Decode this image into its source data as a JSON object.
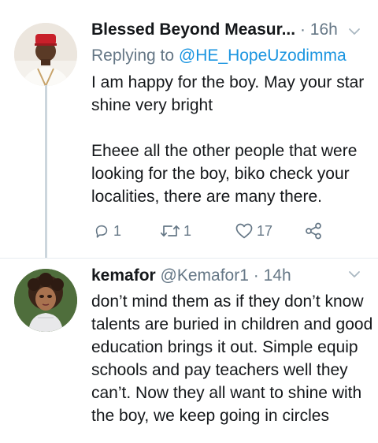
{
  "tweets": [
    {
      "name": "Blessed Beyond Measur...",
      "time": "16h",
      "reply_prefix": "Replying to",
      "reply_to": "@HE_HopeUzodimma",
      "text": "I am happy for the boy. May your star shine very bright\n\nEheee all the other people that were looking for the boy, biko check your localities, there are many there.",
      "counts": {
        "replies": "1",
        "retweets": "1",
        "likes": "17"
      }
    },
    {
      "name": "kemafor",
      "handle": "@Kemafor1",
      "time": "14h",
      "text": "don’t mind them as if they don’t know talents are buried in children and good education brings it out. Simple equip schools and pay teachers well they can’t. Now they all want to shine with the boy, we keep going in circles"
    }
  ],
  "icons": {
    "reply": "reply-icon",
    "retweet": "retweet-icon",
    "like": "heart-icon",
    "share": "share-icon",
    "more": "chevron-down-icon"
  },
  "colors": {
    "link": "#1b95e0",
    "secondary_text": "#657786",
    "thread_line": "#ccd6dd"
  }
}
